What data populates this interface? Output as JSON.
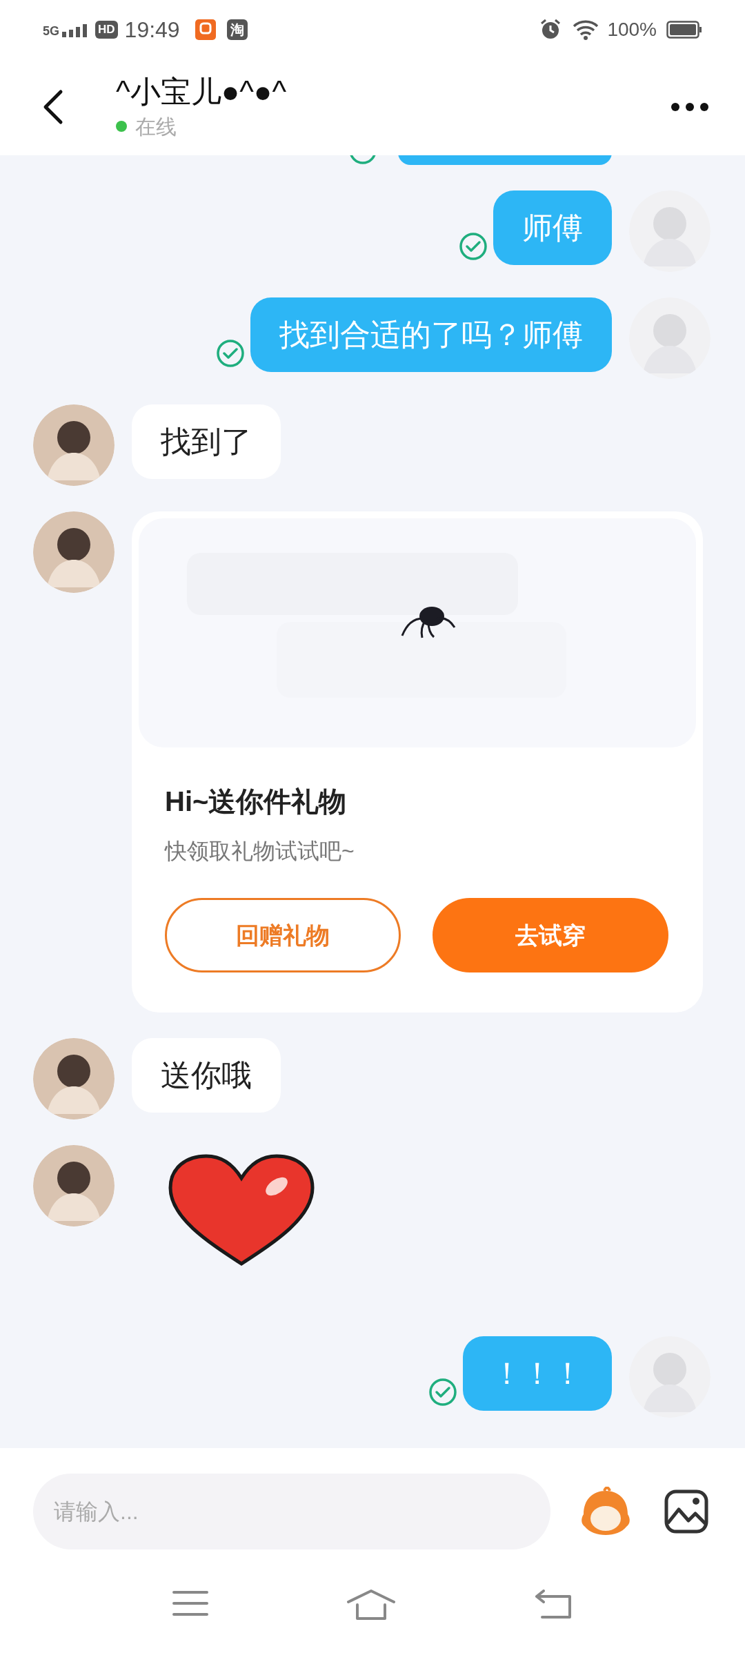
{
  "status_bar": {
    "network": "5G",
    "hd": "HD",
    "time": "19:49",
    "app_icon_text": "淘",
    "battery": "100%"
  },
  "header": {
    "title": "^小宝儿●^●^",
    "status": "在线",
    "online": true
  },
  "messages": [
    {
      "kind": "cut_off",
      "outgoing": true,
      "read": true
    },
    {
      "kind": "text",
      "outgoing": true,
      "text": "师傅",
      "read": true
    },
    {
      "kind": "text",
      "outgoing": true,
      "text": "找到合适的了吗？师傅",
      "read": true
    },
    {
      "kind": "text",
      "outgoing": false,
      "text": "找到了"
    },
    {
      "kind": "gift",
      "outgoing": false,
      "title": "Hi~送你件礼物",
      "subtitle": "快领取礼物试试吧~",
      "buttons": [
        {
          "label": "回赠礼物",
          "kind": "outline"
        },
        {
          "label": "去试穿",
          "kind": "filled"
        }
      ]
    },
    {
      "kind": "text",
      "outgoing": false,
      "text": "送你哦"
    },
    {
      "kind": "sticker",
      "outgoing": false
    },
    {
      "kind": "text",
      "outgoing": true,
      "text": "！！！",
      "read": true
    }
  ],
  "composer": {
    "placeholder": "请输入..."
  }
}
